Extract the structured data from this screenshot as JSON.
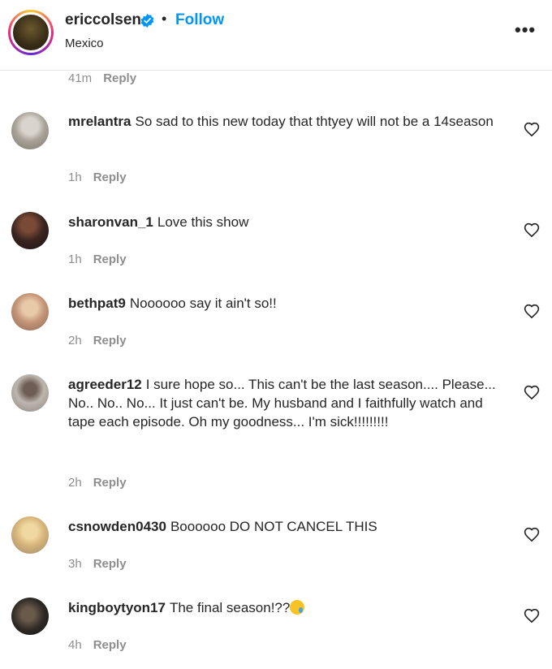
{
  "header": {
    "username": "ericcolsen",
    "separator": "•",
    "follow_label": "Follow",
    "location": "Mexico",
    "more_label": "•••"
  },
  "top_meta": {
    "time": "41m",
    "reply_label": "Reply"
  },
  "comments": [
    {
      "username": "mrelantra",
      "text": "So sad to this new today that thtyey will not be a 14season",
      "time": "1h",
      "reply_label": "Reply"
    },
    {
      "username": "sharonvan_1",
      "text": "Love this show",
      "time": "1h",
      "reply_label": "Reply"
    },
    {
      "username": "bethpat9",
      "text": "Noooooo say it ain't so!!",
      "time": "2h",
      "reply_label": "Reply"
    },
    {
      "username": "agreeder12",
      "text": "I sure hope so... This can't be the last season.... Please... No.. No.. No... It just can't be. My husband and I faithfully watch and tape each episode. Oh my goodness... I'm sick!!!!!!!!!",
      "time": "2h",
      "reply_label": "Reply"
    },
    {
      "username": "csnowden0430",
      "text": "Boooooo DO NOT CANCEL THIS",
      "time": "3h",
      "reply_label": "Reply"
    },
    {
      "username": "kingboytyon17",
      "text": "The final season!??",
      "time": "4h",
      "reply_label": "Reply"
    }
  ],
  "colors": {
    "link": "#0095f6",
    "text": "#262626",
    "muted": "#8e8e8e",
    "verified": "#0095f6"
  },
  "icons": {
    "verified": "verified-badge-icon",
    "like": "heart-outline-icon",
    "more": "more-options-icon"
  }
}
